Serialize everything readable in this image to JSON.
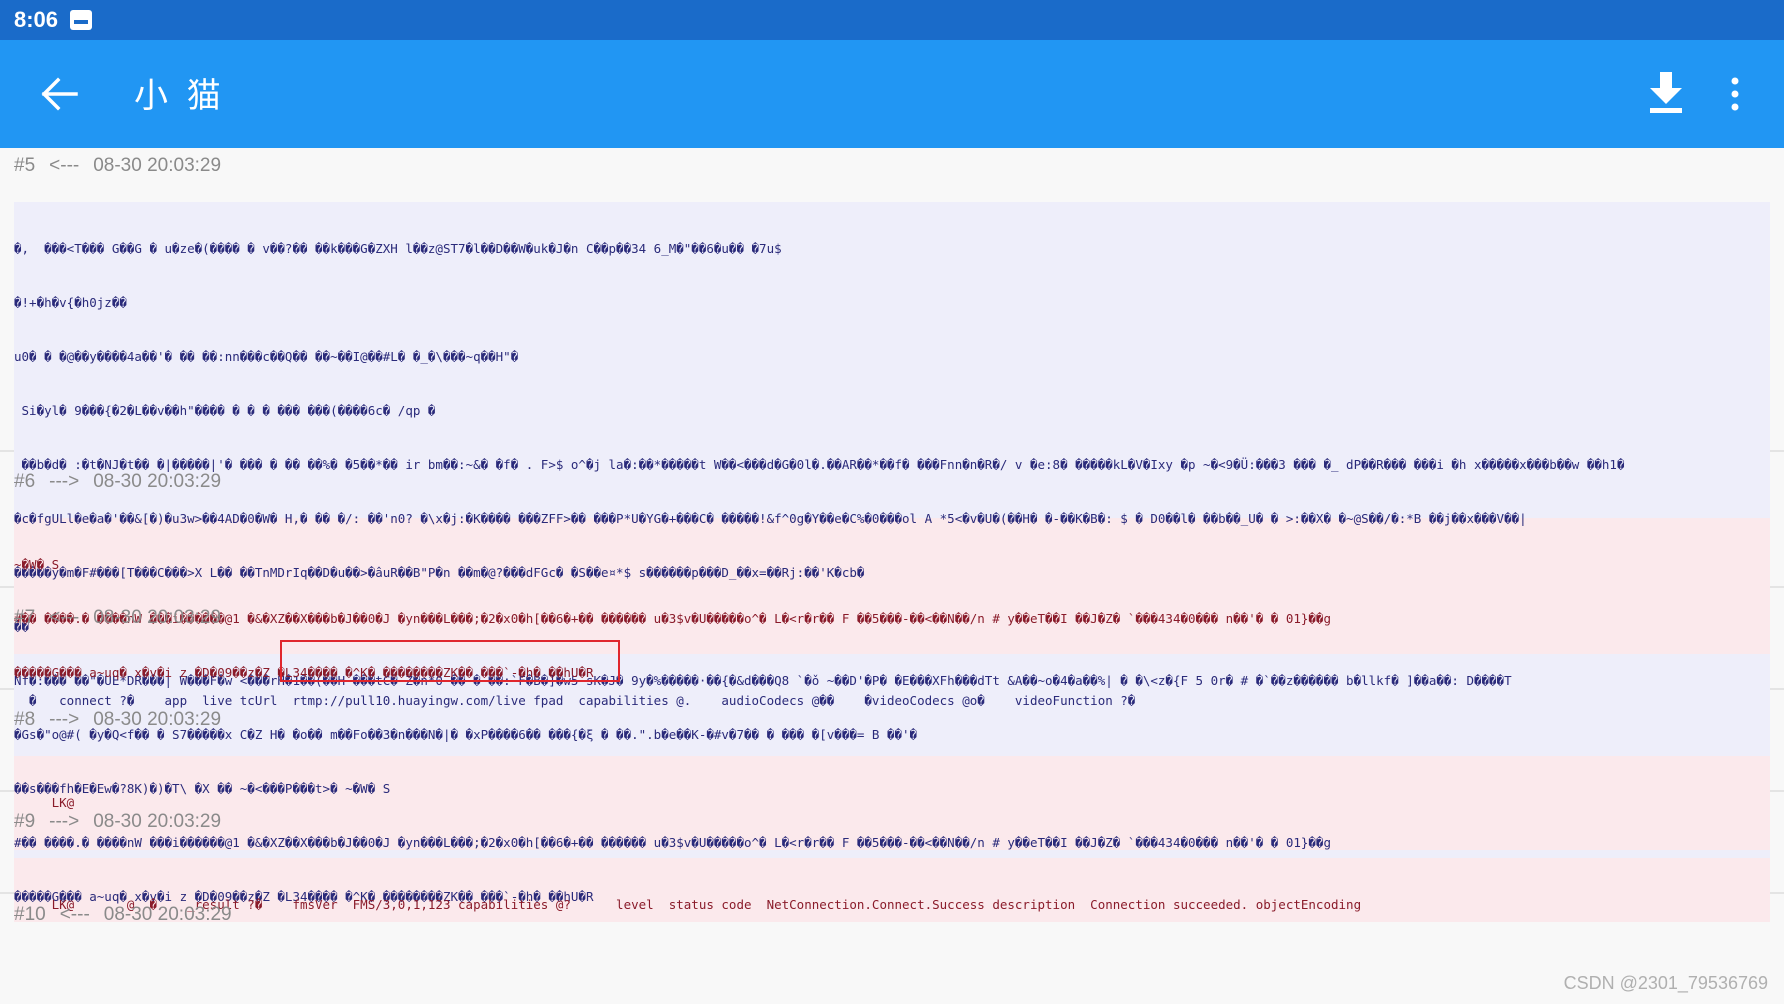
{
  "status_bar": {
    "time": "8:06"
  },
  "app_bar": {
    "title": "小 猫"
  },
  "entries": [
    {
      "index": "#5",
      "dir": "<---",
      "time": "08-30 20:03:29",
      "lines": [
        "�,  ���<T��� G��G � u�ze�(���� � v��?�� ��k���G�ZXH l��z@ST7�l��D��W�uk�J�n C��p��34 6_M�\"��6�u�� �7u$",
        "�!+�h�v{�h0jz��",
        "u0� � �@��y����4a��'� �� ��:nn���c��Q�� ��~��I@��#L� �_�\\���~q��H\"�",
        " Si�yl� 9���{�2�L��v��h\"���� � � � ��� ���(����6c� /qp �",
        " ��b�d� :�t�NJ�t�� �|�����|'� ��� � �� ��%� �5��*�� ir bm��:~&� �f� . F>$ o^�j la�:��*�����t W��<���d�G�0l�.��AR��*��f� ���Fnn�n�R�/ v �e:8� �����kL�V�Ixy �p ~�<9�Ü:���3 ��� �_ dP��R��� ���i �h x�����x���b��w ��h1�",
        "�c�fgULl�e�a�'��&[�)�u3w>��4AD�0�W� H,� �� �/: ��'n0? �\\x�j:�K���� ���ZFF>�� ���P*U�YG�+���C� �����!&f^0g�Y��e�C%�0���ol A *5<�v�U�(��H� �-��K�B�: $ � D0��l� ��b��_U� � >:��X� �~@S��/�:*B ��j��x���V��|",
        "�����y�m�F#���[T���C���>X L�� ��TnMDrIq��D�u��>�âuR��B\"P�n ��m�@?���dFGc� �S��e¤*$ s������p���D_��x=��Rj:��'K�cb�",
        "��",
        "Nf�:��� ��\"�UE*DR���| W���F�w <���rH�1��(��H ���tC� Z�n*0 �� � ��:`F�B�]�w5 sK�J� 9y�%�����·��{�&d���Q8 `�ǒ ~��D'�P� �E���XFh���dTt &A��~o�4�a��%| � �\\<z�{F 5 0r� # �`��z������ b�llkf� ]��a��: D����T",
        "�Gs�\"o@#( �y�Q<f�� � S7�����x C�Z H� �o�� m��Fo��3�n���N�|� �xP����6�� ���{�ξ � ��.\".b�e��K-�#v�7�� � ��� �[v���= B ��'�",
        "��s���fh�E�Ew�?8K)�)�T\\ �X �� ~�<���P���t>� ~�W� S",
        "#�� ����.� ����nW ���i������@1 �&�XZ��X���b�J��0�J �yn���L���;�2�x0�h[��6�+�� ������ u�3$v�U�����o^� L�<r�r�� F ��5���-��<��N��/n # y��eT��I ��J�Z� `���434�0��� n��'� � 01}��g",
        "�����G��� a~uq� x�v�i z �D�09��z�Z �L34���� �^K� ��������ZK�� ���`-�h� ��hU�R"
      ]
    },
    {
      "index": "#6",
      "dir": "--->",
      "time": "08-30 20:03:29",
      "lines": [
        "~�W� S",
        "#�� ����.� ����nW ���i������@1 �&�XZ��X���b�J��0�J �yn���L���;�2�x0�h[��6�+�� ������ u�3$v�U�����o^� L�<r�r�� F ��5���-��<��N��/n # y��eT��I ��J�Z� `���434�0��� n��'� � 01}��g",
        "�����G��� a~uq� x�v�i z �D�09��z�Z �L34���� �^K� ��������ZK�� ���`-�h� ��hU�R"
      ]
    },
    {
      "index": "#7",
      "dir": "<---",
      "time": "08-30 20:03:29",
      "lines": [
        "  �   connect ?�    app  live tcUrl  rtmp://pull10.huayingw.com/live fpad  capabilities @.    audioCodecs @��    �videoCodecs @o�    videoFunction ?�"
      ]
    },
    {
      "index": "#8",
      "dir": "--->",
      "time": "08-30 20:03:29",
      "lines": [
        "     LK@"
      ]
    },
    {
      "index": "#9",
      "dir": "--->",
      "time": "08-30 20:03:29",
      "lines": [
        "     LK@       @  �    _result ?�    fmsVer  FMS/3,0,1,123 capabilities @?      level  status code  NetConnection.Connect.Success description  Connection succeeded. objectEncoding"
      ]
    },
    {
      "index": "#10",
      "dir": "<---",
      "time": "08-30 20:03:29",
      "lines": []
    }
  ],
  "watermark": "CSDN @2301_79536769",
  "icons": [
    "arrow-back-icon",
    "download-icon",
    "more-vert-icon"
  ]
}
